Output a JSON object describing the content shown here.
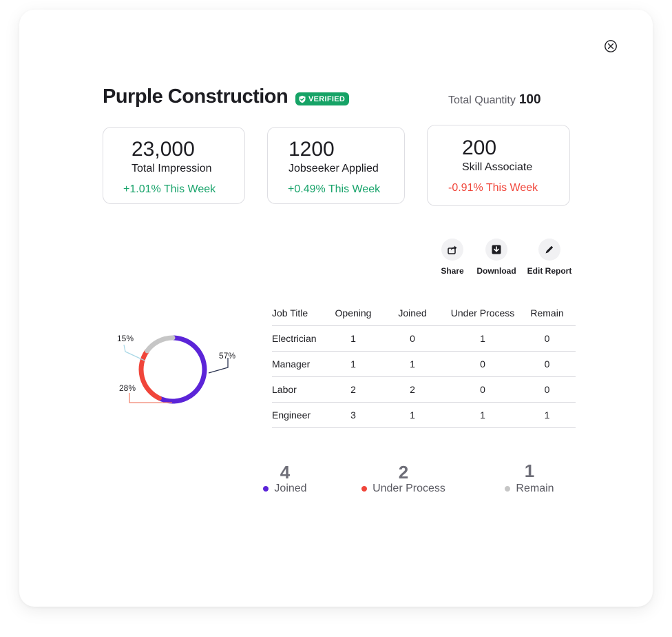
{
  "header": {
    "company_name": "Purple Construction",
    "verified_label": "VERIFIED",
    "total_quantity_label": "Total Quantity",
    "total_quantity_value": "100"
  },
  "stats": [
    {
      "value": "23,000",
      "label": "Total Impression",
      "change": "+1.01% This Week",
      "trend": "up"
    },
    {
      "value": "1200",
      "label": "Jobseeker Applied",
      "change": "+0.49% This Week",
      "trend": "up"
    },
    {
      "value": "200",
      "label": "Skill Associate",
      "change": "-0.91% This Week",
      "trend": "down"
    }
  ],
  "actions": {
    "share_label": "Share",
    "download_label": "Download",
    "edit_label": "Edit Report"
  },
  "colors": {
    "joined": "#5b24d8",
    "under_process": "#f0453a",
    "remain": "#c6c6c6",
    "up": "#17a36a",
    "down": "#f0453a"
  },
  "donut": {
    "segments": [
      {
        "label": "57%",
        "value": 57,
        "color": "#5b24d8"
      },
      {
        "label": "28%",
        "value": 28,
        "color": "#f0453a"
      },
      {
        "label": "15%",
        "value": 15,
        "color": "#c6c6c6"
      }
    ]
  },
  "table": {
    "headers": [
      "Job Title",
      "Opening",
      "Joined",
      "Under Process",
      "Remain"
    ],
    "rows": [
      [
        "Electrician",
        "1",
        "0",
        "1",
        "0"
      ],
      [
        "Manager",
        "1",
        "1",
        "0",
        "0"
      ],
      [
        "Labor",
        "2",
        "2",
        "0",
        "0"
      ],
      [
        "Engineer",
        "3",
        "1",
        "1",
        "1"
      ]
    ]
  },
  "summary": [
    {
      "value": "4",
      "label": "Joined"
    },
    {
      "value": "2",
      "label": "Under Process"
    },
    {
      "value": "1",
      "label": "Remain"
    }
  ]
}
